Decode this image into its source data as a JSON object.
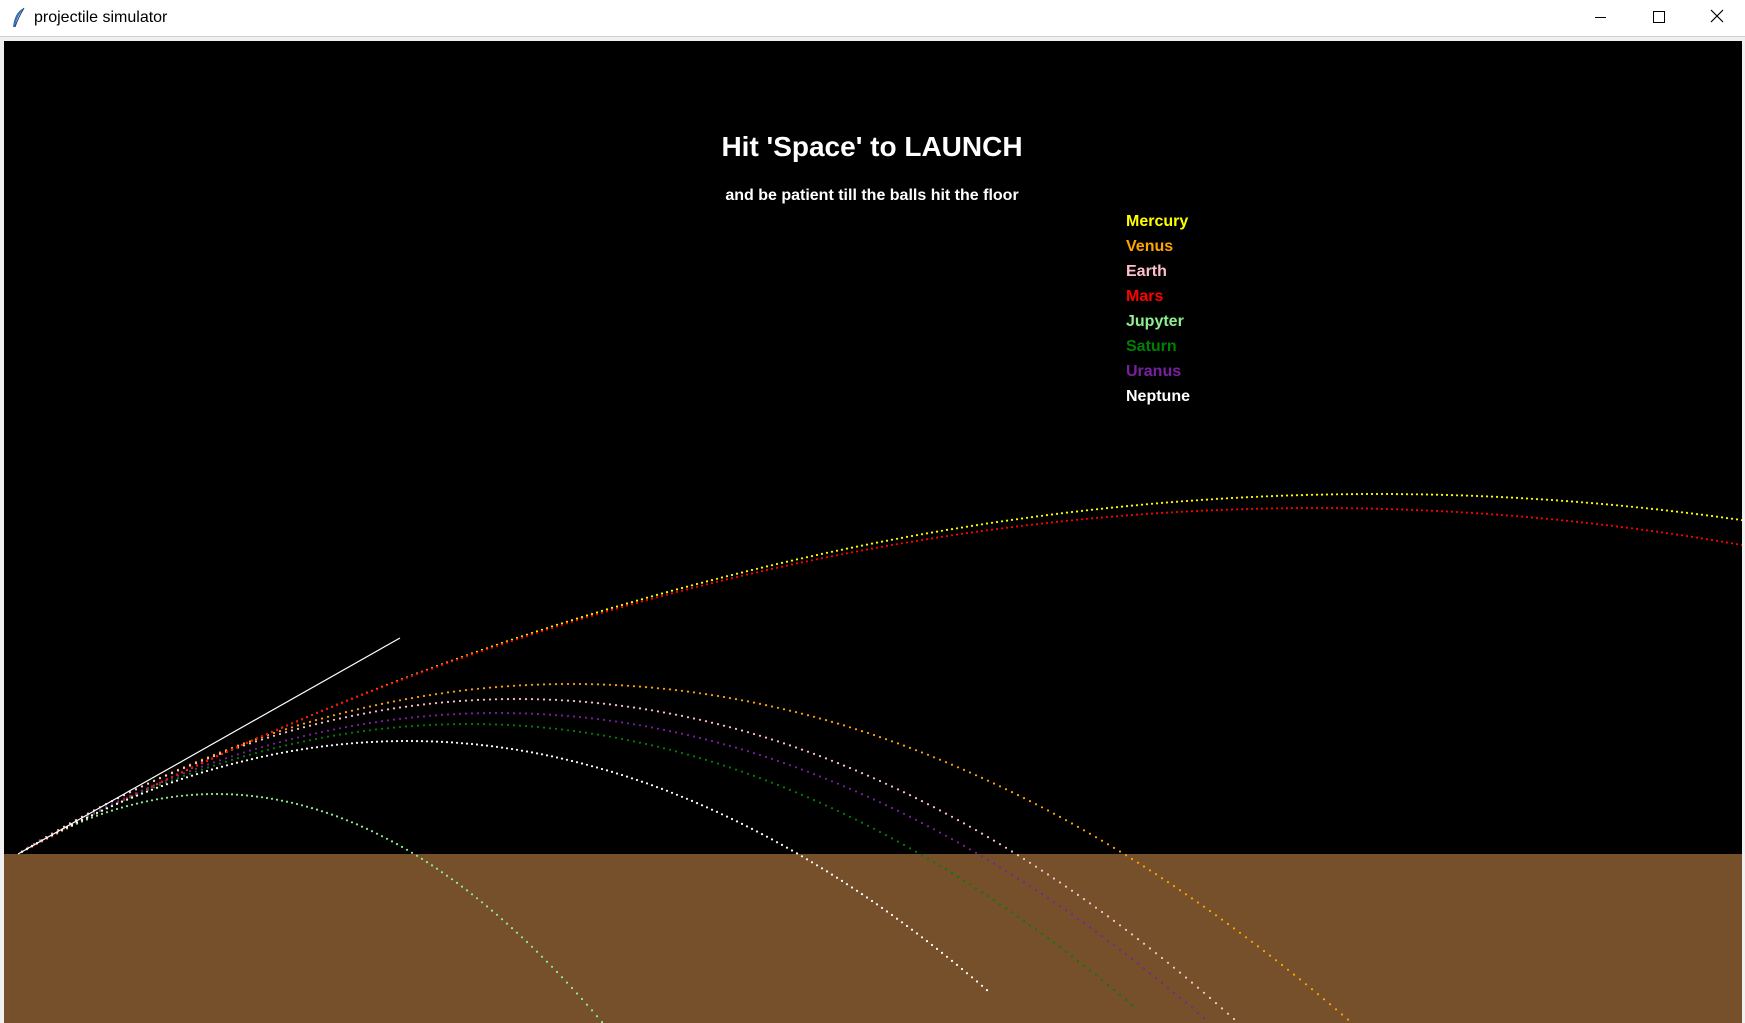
{
  "window": {
    "title": "projectile simulator",
    "icon": "feather-icon",
    "controls": [
      "minimize-icon",
      "maximize-icon",
      "close-icon"
    ]
  },
  "canvas": {
    "background": "#000000",
    "ground_color": "#75502a",
    "heading": "Hit 'Space' to LAUNCH",
    "subheading": "and be patient till the balls hit the floor"
  },
  "legend": [
    {
      "label": "Mercury",
      "color": "#ffff00"
    },
    {
      "label": "Venus",
      "color": "#ffa500"
    },
    {
      "label": "Earth",
      "color": "#ffc0cb"
    },
    {
      "label": "Mars",
      "color": "#ff0000"
    },
    {
      "label": "Jupyter",
      "color": "#90ee90"
    },
    {
      "label": "Saturn",
      "color": "#008000"
    },
    {
      "label": "Uranus",
      "color": "#7b1fa2"
    },
    {
      "label": "Neptune",
      "color": "#ffffff"
    }
  ]
}
